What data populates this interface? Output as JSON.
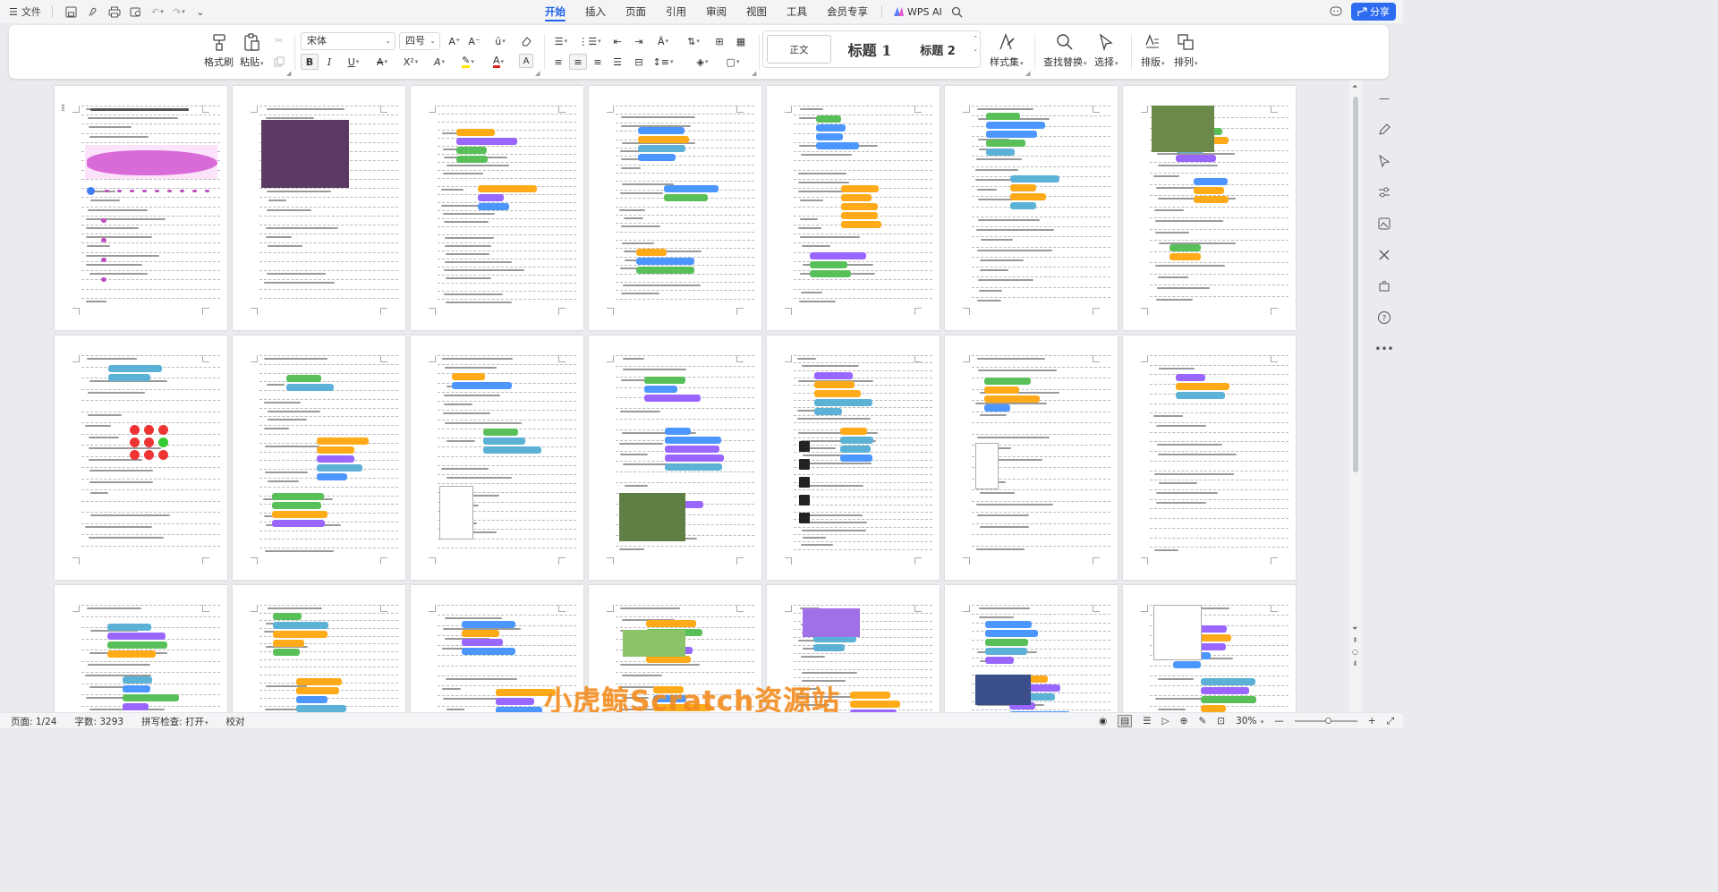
{
  "titlebar": {
    "file_menu": "文件",
    "tabs": [
      "开始",
      "插入",
      "页面",
      "引用",
      "审阅",
      "视图",
      "工具",
      "会员专享"
    ],
    "active_tab": "开始",
    "ai_label": "WPS AI",
    "share_label": "分享"
  },
  "ribbon": {
    "format_painter": "格式刷",
    "paste": "粘贴",
    "font_name": "宋体",
    "font_size": "四号",
    "style_normal": "正文",
    "style_h1": "标题 1",
    "style_h2": "标题 2",
    "style_set": "样式集",
    "find_replace": "查找替换",
    "select": "选择",
    "layout": "排版",
    "arrange": "排列"
  },
  "status": {
    "page": "页面: 1/24",
    "words": "字数: 3293",
    "spell": "拼写检查: 打开",
    "proof": "校对",
    "zoom": "30%"
  },
  "watermark": "小虎鲸Scratch资源站",
  "colors": {
    "accent": "#2160e8",
    "share": "#2d6cf0",
    "watermark": "#f28b1e"
  }
}
